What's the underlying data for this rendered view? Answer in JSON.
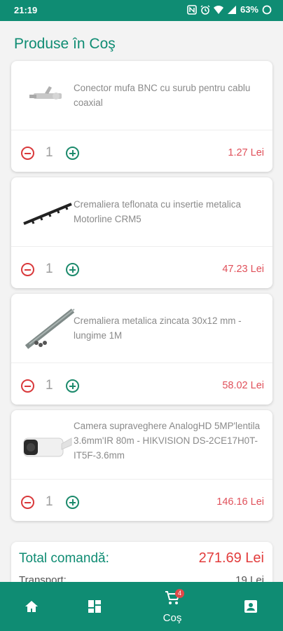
{
  "status_bar": {
    "time": "21:19",
    "battery": "63%"
  },
  "page": {
    "title": "Produse în Coş"
  },
  "cart_items": [
    {
      "name": "Conector mufa  BNC cu surub pentru cablu coaxial",
      "quantity": "1",
      "price": "1.27 Lei",
      "image_icon": "bnc-connector-image"
    },
    {
      "name": "Cremaliera teflonata cu insertie metalica Motorline CRM5",
      "quantity": "1",
      "price": "47.23 Lei",
      "image_icon": "rack-teflon-image"
    },
    {
      "name": "Cremaliera metalica zincata 30x12 mm - lungime 1M",
      "quantity": "1",
      "price": "58.02 Lei",
      "image_icon": "rack-metal-image"
    },
    {
      "name": "Camera supraveghere AnalogHD 5MP'lentila 3.6mm'IR 80m - HIKVISION DS-2CE17H0T-IT5F-3.6mm",
      "quantity": "1",
      "price": "146.16 Lei",
      "image_icon": "camera-image"
    }
  ],
  "totals": {
    "total_label": "Total comandă:",
    "total_value": "271.69 Lei",
    "transport_label": "Transport:",
    "transport_value": "19 Lei"
  },
  "bottom_nav": {
    "home_icon": "home-icon",
    "dashboard_icon": "dashboard-icon",
    "cart_label": "Coş",
    "cart_badge": "4",
    "account_icon": "account-box-icon"
  },
  "colors": {
    "primary": "#0f8c73",
    "price": "#e0505a",
    "minus": "#d9393b",
    "plus": "#1c8a6c"
  }
}
